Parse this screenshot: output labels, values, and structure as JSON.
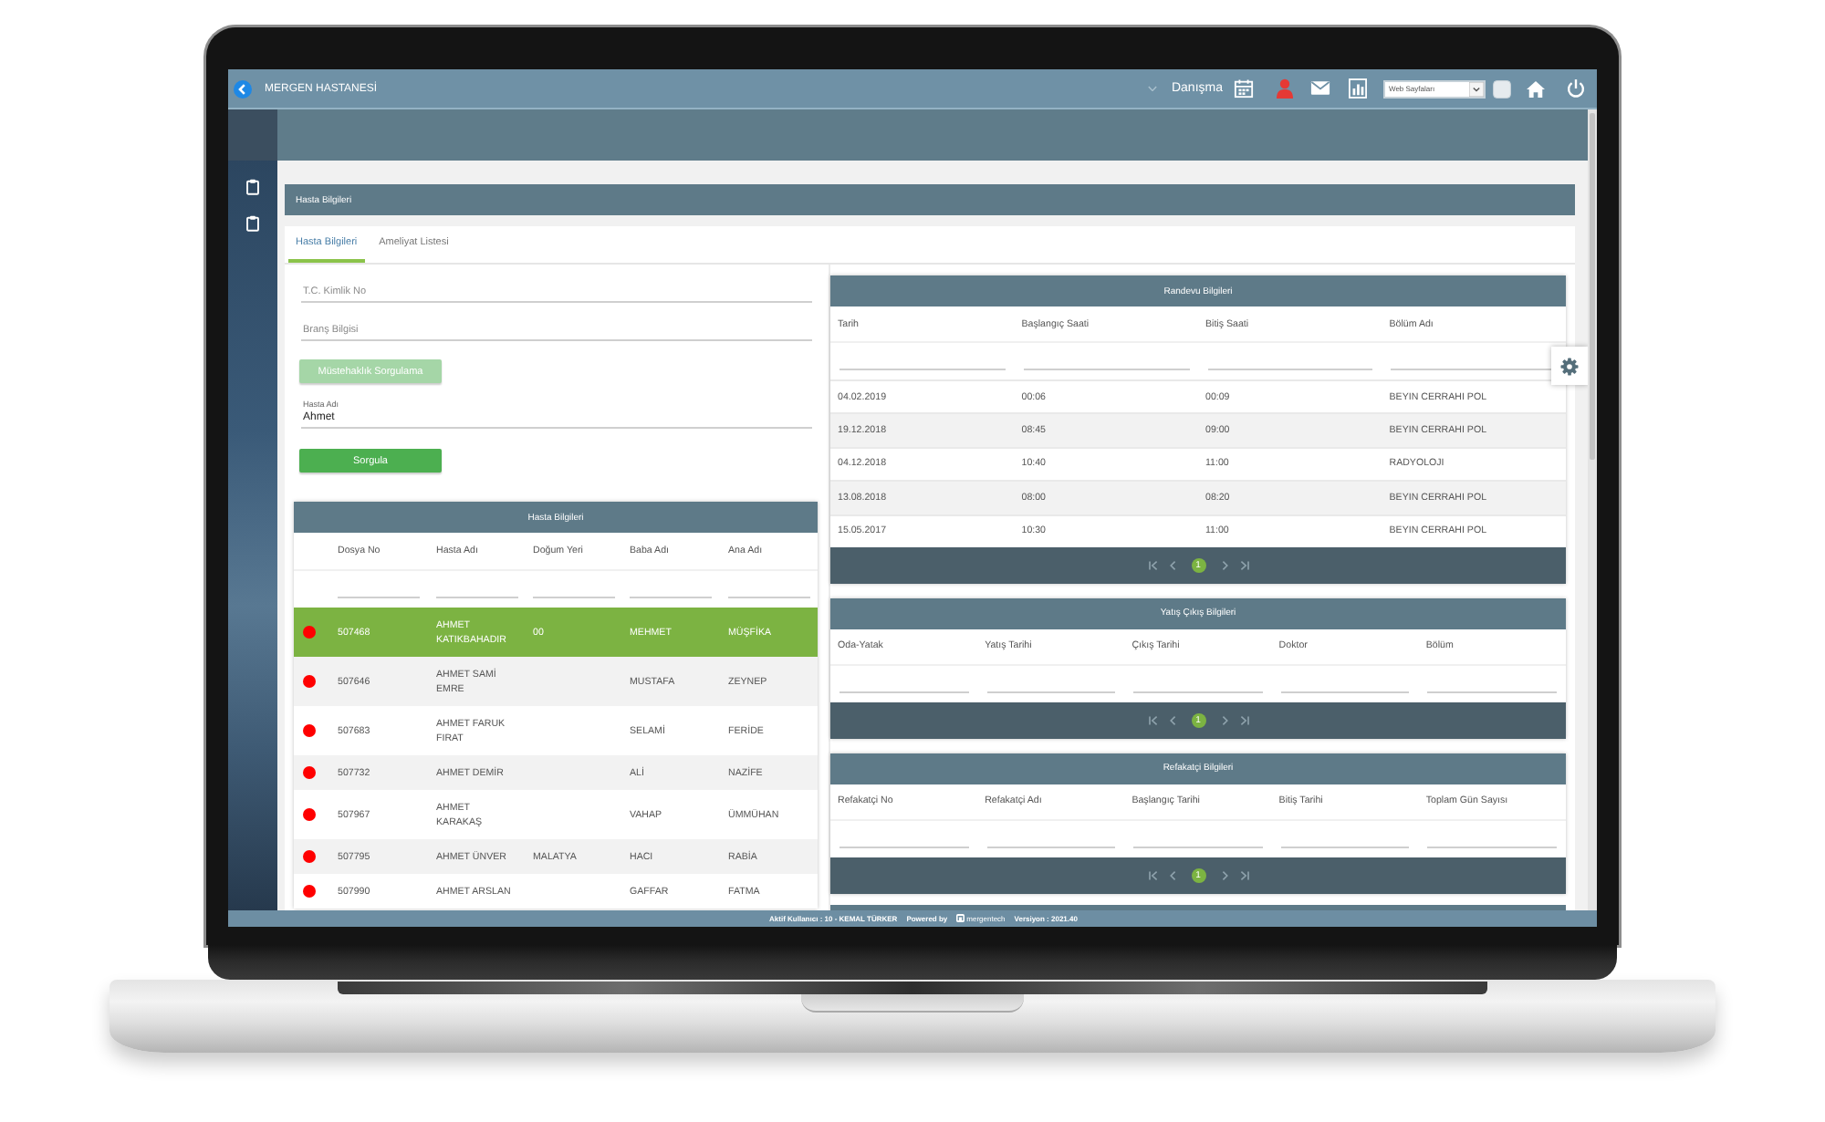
{
  "topbar": {
    "title": "MERGEN HASTANESİ",
    "module": "Danışma",
    "web_select": {
      "value": "Web Sayfaları"
    }
  },
  "page_title": "Hasta Bilgileri",
  "tabs": [
    {
      "label": "Hasta Bilgileri",
      "selected": true
    },
    {
      "label": "Ameliyat Listesi",
      "selected": false
    }
  ],
  "search_form": {
    "tc_field": {
      "placeholder": "T.C. Kimlik No"
    },
    "branch_field": {
      "placeholder": "Branş Bilgisi"
    },
    "eligibility_button": {
      "label": "Müstehaklık Sorgulama",
      "disabled": true
    },
    "name_field": {
      "label": "Hasta Adı",
      "value": "Ahmet"
    },
    "query_button": {
      "label": "Sorgula",
      "disabled": false
    }
  },
  "patients": {
    "title": "Hasta Bilgileri",
    "columns": [
      "Dosya No",
      "Hasta Adı",
      "Doğum Yeri",
      "Baba Adı",
      "Ana Adı"
    ],
    "rows": [
      {
        "selected": true,
        "color": "#ff0000",
        "file_no": "507468",
        "name": "AHMET KATIKBAHADIR",
        "birthplace": "00",
        "father": "MEHMET",
        "mother": "MÜŞFİKA"
      },
      {
        "selected": false,
        "color": "#ff0000",
        "file_no": "507646",
        "name": "AHMET SAMİ EMRE",
        "father": "MUSTAFA",
        "mother": "ZEYNEP"
      },
      {
        "selected": false,
        "color": "#ff0000",
        "file_no": "507683",
        "name": "AHMET FARUK FIRAT",
        "father": "SELAMİ",
        "mother": "FERİDE"
      },
      {
        "selected": false,
        "color": "#ff0000",
        "file_no": "507732",
        "name": "AHMET DEMİR",
        "father": "ALİ",
        "mother": "NAZİFE"
      },
      {
        "selected": false,
        "color": "#ff0000",
        "file_no": "507967",
        "name": "AHMET KARAKAŞ",
        "father": "VAHAP",
        "mother": "ÜMMÜHAN"
      },
      {
        "selected": false,
        "color": "#ff0000",
        "file_no": "507795",
        "name": "AHMET ÜNVER",
        "birthplace": "MALATYA",
        "father": "HACI",
        "mother": "RABİA"
      },
      {
        "selected": false,
        "color": "#ff0000",
        "file_no": "507990",
        "name": "AHMET ARSLAN",
        "father": "GAFFAR",
        "mother": "FATMA"
      }
    ]
  },
  "grids": [
    {
      "title": "Randevu Bilgileri",
      "columns": [
        "Tarih",
        "Başlangıç Saati",
        "Bitiş Saati",
        "Bölüm Adı"
      ],
      "rows": [
        [
          "04.02.2019",
          "00:06",
          "00:09",
          "BEYIN CERRAHI POL"
        ],
        [
          "19.12.2018",
          "08:45",
          "09:00",
          "BEYIN CERRAHI POL"
        ],
        [
          "04.12.2018",
          "10:40",
          "11:00",
          "RADYOLOJI"
        ],
        [
          "13.08.2018",
          "08:00",
          "08:20",
          "BEYIN CERRAHI POL"
        ],
        [
          "15.05.2017",
          "10:30",
          "11:00",
          "BEYIN CERRAHI POL"
        ]
      ],
      "pager": {
        "pages": [
          {
            "label": "1",
            "selected": true
          }
        ]
      }
    },
    {
      "title": "Yatış Çıkış Bilgileri",
      "columns": [
        "Oda-Yatak",
        "Yatış Tarihi",
        "Çıkış Tarihi",
        "Doktor",
        "Bölüm"
      ],
      "pager": {
        "pages": [
          {
            "label": "1",
            "selected": true
          }
        ]
      }
    },
    {
      "title": "Refakatçi Bilgileri",
      "columns": [
        "Refakatçi No",
        "Refakatçi Adı",
        "Başlangıç Tarihi",
        "Bitiş Tarihi",
        "Toplam Gün Sayısı"
      ],
      "pager": {
        "pages": [
          {
            "label": "1",
            "selected": true
          }
        ]
      }
    }
  ],
  "footer": {
    "user": "Aktif Kullanıcı : 10 - KEMAL TÜRKER",
    "powered_by": "Powered by",
    "logo_text": "mergentech",
    "version": "Versiyon : 2021.40"
  }
}
